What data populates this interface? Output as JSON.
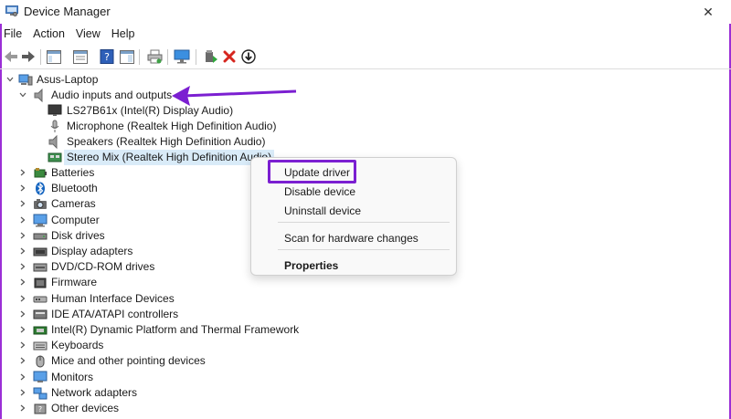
{
  "window": {
    "title": "Device Manager",
    "close_glyph": "✕"
  },
  "menu": [
    "File",
    "Action",
    "View",
    "Help"
  ],
  "toolbar": {
    "icons": [
      "back-arrow-icon",
      "forward-arrow-icon",
      "show-hide-tree-icon",
      "properties-icon",
      "help-icon",
      "action-pane-icon",
      "print-icon",
      "monitor-icon",
      "add-driver-icon",
      "uninstall-x-icon",
      "download-driver-icon"
    ]
  },
  "tree": {
    "root": "Asus-Laptop",
    "expanded_category": "Audio inputs and outputs",
    "audio_devices": [
      "LS27B61x (Intel(R) Display Audio)",
      "Microphone (Realtek High Definition Audio)",
      "Speakers (Realtek High Definition Audio)",
      "Stereo Mix (Realtek High Definition Audio)"
    ],
    "categories": [
      "Batteries",
      "Bluetooth",
      "Cameras",
      "Computer",
      "Disk drives",
      "Display adapters",
      "DVD/CD-ROM drives",
      "Firmware",
      "Human Interface Devices",
      "IDE ATA/ATAPI controllers",
      "Intel(R) Dynamic Platform and Thermal Framework",
      "Keyboards",
      "Mice and other pointing devices",
      "Monitors",
      "Network adapters",
      "Other devices"
    ]
  },
  "context_menu": {
    "update_driver": "Update driver",
    "disable_device": "Disable device",
    "uninstall_device": "Uninstall device",
    "scan": "Scan for hardware changes",
    "properties": "Properties"
  },
  "colors": {
    "annotation": "#7b1fd1",
    "selection": "#d9ebf8"
  }
}
